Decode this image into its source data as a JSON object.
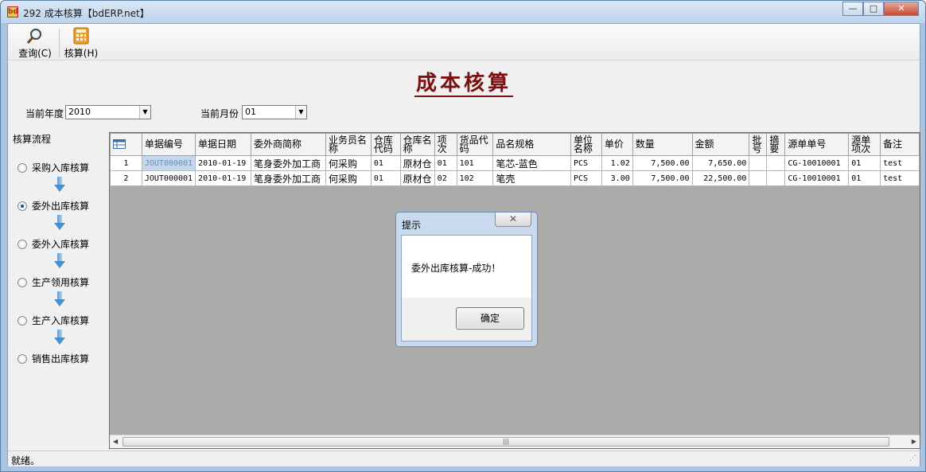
{
  "window": {
    "title": "292 成本核算【bdERP.net】",
    "app_icon_text": "bd",
    "min_label": "—",
    "max_label": "□",
    "close_label": "✕"
  },
  "toolbar": {
    "query_label": "查询(C)",
    "calc_label": "核算(H)"
  },
  "heading": "成本核算",
  "filters": {
    "year_label": "当前年度",
    "year_value": "2010",
    "month_label": "当前月份",
    "month_value": "01"
  },
  "flow": {
    "title": "核算流程",
    "items": [
      {
        "label": "采购入库核算",
        "selected": false
      },
      {
        "label": "委外出库核算",
        "selected": true
      },
      {
        "label": "委外入库核算",
        "selected": false
      },
      {
        "label": "生产领用核算",
        "selected": false
      },
      {
        "label": "生产入库核算",
        "selected": false
      },
      {
        "label": "销售出库核算",
        "selected": false
      }
    ]
  },
  "grid": {
    "columns": [
      "单据编号",
      "单据日期",
      "委外商简称",
      "业务员名称",
      "仓库代码",
      "仓库名称",
      "项次",
      "货品代码",
      "品名规格",
      "单位名称",
      "单价",
      "数量",
      "金额",
      "批号",
      "摘要",
      "源单单号",
      "源单项次",
      "备注"
    ],
    "rows": [
      [
        "1",
        "JOUT000001",
        "2010-01-19",
        "笔身委外加工商",
        "何采购",
        "01",
        "原材仓",
        "01",
        "101",
        "笔芯-蓝色",
        "PCS",
        "1.02",
        "7,500.00",
        "7,650.00",
        "",
        "",
        "CG-10010001",
        "01",
        "test"
      ],
      [
        "2",
        "JOUT000001",
        "2010-01-19",
        "笔身委外加工商",
        "何采购",
        "01",
        "原材仓",
        "02",
        "102",
        "笔壳",
        "PCS",
        "3.00",
        "7,500.00",
        "22,500.00",
        "",
        "",
        "CG-10010001",
        "01",
        "test"
      ]
    ]
  },
  "status": {
    "text": "就绪。"
  },
  "dialog": {
    "title": "提示",
    "message": "委外出库核算-成功！",
    "ok_label": "确定",
    "close_label": "✕"
  }
}
